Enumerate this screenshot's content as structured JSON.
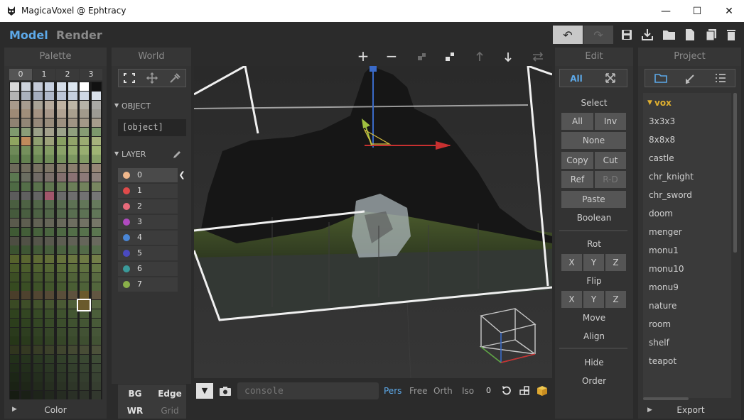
{
  "window": {
    "title": "MagicaVoxel @ Ephtracy",
    "minimize": "—",
    "maximize": "☐",
    "close": "✕"
  },
  "modes": {
    "model": "Model",
    "render": "Render"
  },
  "toolbar": {
    "undo": "↶",
    "redo": "↷"
  },
  "palette": {
    "header": "Palette",
    "indices": [
      "0",
      "1",
      "2",
      "3"
    ],
    "footer": "Color",
    "colors": [
      [
        "#d8d8d8",
        "#cdd3dc",
        "#c4cad7",
        "#c7d0e0",
        "#d5dde8",
        "#dce6f0",
        "#ffffff",
        "#111111"
      ],
      [
        "#b4b4b4",
        "#aab1bd",
        "#a5adbe",
        "#b0b8c9",
        "#bdc6d6",
        "#c6d0de",
        "#cfd8e5",
        "#d9e0ea"
      ],
      [
        "#a89a8c",
        "#a69c90",
        "#a8a396",
        "#b5aa9c",
        "#bfb3a3",
        "#bdb6a6",
        "#b6b3a8",
        "#a9a8a5"
      ],
      [
        "#9e8a76",
        "#a08e7a",
        "#a49282",
        "#a8988a",
        "#b0a292",
        "#a99f8e",
        "#a29a8c",
        "#9c9a93"
      ],
      [
        "#8f8272",
        "#928676",
        "#96887a",
        "#998c7c",
        "#9d9080",
        "#a09484",
        "#a39888",
        "#a69c8c"
      ],
      [
        "#7f9a6e",
        "#8b9d78",
        "#9aa088",
        "#a3a18c",
        "#9ba38a",
        "#91a07e",
        "#879c74",
        "#7c986c"
      ],
      [
        "#8fa560",
        "#c08b5c",
        "#8f9f70",
        "#9ca27a",
        "#88a062",
        "#92a46a",
        "#9bab72",
        "#a6b27c"
      ],
      [
        "#6e8a58",
        "#75905c",
        "#7c9660",
        "#839c64",
        "#8aa268",
        "#91a86c",
        "#98ae70",
        "#9fb474"
      ],
      [
        "#5e7d4c",
        "#648250",
        "#6a8754",
        "#708c58",
        "#76915c",
        "#7c9660",
        "#829b64",
        "#88a068"
      ],
      [
        "#6c6a5a",
        "#726e5e",
        "#787262",
        "#7e7666",
        "#847a6a",
        "#8a7e6e",
        "#908272",
        "#968676"
      ],
      [
        "#5b7850",
        "#6a6d60",
        "#716b66",
        "#7a6f6a",
        "#836f6e",
        "#8a7274",
        "#8c7a78",
        "#8e827c"
      ],
      [
        "#4e6a44",
        "#546e48",
        "#5a724c",
        "#607650",
        "#667a54",
        "#6c7e58",
        "#72825c",
        "#788660"
      ],
      [
        "#5c5c5c",
        "#606060",
        "#646464",
        "#a1566b",
        "#6a6a6a",
        "#6e6e6e",
        "#727272",
        "#767676"
      ],
      [
        "#4a5e40",
        "#4e6244",
        "#526648",
        "#566a4c",
        "#5a6e50",
        "#5e7254",
        "#627658",
        "#667a5c"
      ],
      [
        "#455a3c",
        "#495e40",
        "#4d6244",
        "#516648",
        "#556a4c",
        "#596e50",
        "#5d7254",
        "#617658"
      ],
      [
        "#5a5a4c",
        "#5e5e50",
        "#626254",
        "#666658",
        "#6a6a5c",
        "#6e6e60",
        "#727264",
        "#767668"
      ],
      [
        "#3f5a34",
        "#435e38",
        "#47623c",
        "#4b6640",
        "#4f6a44",
        "#536e48",
        "#57724c",
        "#5b7650"
      ],
      [
        "#4d4d42",
        "#515146",
        "#55554a",
        "#59594e",
        "#5d5d52",
        "#616156",
        "#65655a",
        "#69695e"
      ],
      [
        "#3b5230",
        "#3f5634",
        "#435a38",
        "#475e3c",
        "#4b6240",
        "#4f6644",
        "#536a48",
        "#576e4c"
      ],
      [
        "#56622c",
        "#5a6630",
        "#5e6a34",
        "#626e38",
        "#66723c",
        "#6a7640",
        "#6e7a44",
        "#727e48"
      ],
      [
        "#485a28",
        "#4c5e2c",
        "#506230",
        "#546634",
        "#586a38",
        "#5c6e3c",
        "#607240",
        "#647644"
      ],
      [
        "#3c4e24",
        "#405228",
        "#44562c",
        "#485a30",
        "#4c5e34",
        "#506238",
        "#54663c",
        "#586a40"
      ],
      [
        "#364a20",
        "#3a4e24",
        "#3e5228",
        "#42562c",
        "#465a30",
        "#4a5e34",
        "#4e6238",
        "#52663c"
      ],
      [
        "#4a3e2a",
        "#4e422e",
        "#524632",
        "#564a36",
        "#5a4e3a",
        "#5e523e",
        "#6a5a2c",
        "#625642"
      ],
      [
        "#3a4a24",
        "#3e4e28",
        "#42522c",
        "#465630",
        "#4a5a34",
        "#4e5e38",
        "#52623c",
        "#566640"
      ],
      [
        "#2f421e",
        "#334622",
        "#374a26",
        "#3b4e2a",
        "#3f522e",
        "#435632",
        "#475a36",
        "#4b5e3a"
      ],
      [
        "#2c3e1c",
        "#304220",
        "#344624",
        "#384a28",
        "#3c4e2c",
        "#405230",
        "#445634",
        "#485a38"
      ],
      [
        "#2a3a1c",
        "#2e3e20",
        "#324224",
        "#364628",
        "#3a4a2c",
        "#3e4e30",
        "#425234",
        "#465638"
      ],
      [
        "#263618",
        "#2a3a1c",
        "#2e3e20",
        "#324224",
        "#364628",
        "#3a4a2c",
        "#3e4e30",
        "#425234"
      ],
      [
        "#30351e",
        "#343922",
        "#383d26",
        "#3c412a",
        "#40452e",
        "#444932",
        "#484d36",
        "#4c513a"
      ],
      [
        "#22301a",
        "#26341e",
        "#2a3822",
        "#2e3c26",
        "#32402a",
        "#36442e",
        "#3a4832",
        "#3e4c36"
      ],
      [
        "#1f2b18",
        "#232f1c",
        "#273320",
        "#2b3724",
        "#2f3b28",
        "#333f2c",
        "#374330",
        "#3b4734"
      ],
      [
        "#1c2616",
        "#202a1a",
        "#242e1e",
        "#283222",
        "#2c3626",
        "#303a2a",
        "#343e2e",
        "#384232"
      ],
      [
        "#1a2214",
        "#1e2618",
        "#222a1c",
        "#262e20",
        "#2a3224",
        "#2e3628",
        "#323a2c",
        "#363e30"
      ],
      [
        "#161c12",
        "#1a2016",
        "#1e241a",
        "#22281e",
        "#262c22",
        "#2a3026",
        "#2e342a",
        "#32382e"
      ]
    ]
  },
  "world": {
    "header": "World",
    "object_section": "OBJECT",
    "object_value": "[object]",
    "layer_section": "LAYER",
    "layers": [
      {
        "name": "0",
        "color": "#f0b88c"
      },
      {
        "name": "1",
        "color": "#e04a4a"
      },
      {
        "name": "2",
        "color": "#e86a7a"
      },
      {
        "name": "3",
        "color": "#b04ac0"
      },
      {
        "name": "4",
        "color": "#4a86d6"
      },
      {
        "name": "5",
        "color": "#4a4ac0"
      },
      {
        "name": "6",
        "color": "#3a9a9a"
      },
      {
        "name": "7",
        "color": "#8ab04a"
      }
    ],
    "bg": "BG",
    "edge": "Edge",
    "wr": "WR",
    "grid": "Grid"
  },
  "viewport": {
    "add": "+",
    "remove": "−",
    "console_placeholder": "console",
    "pers": "Pers",
    "free": "Free",
    "orth": "Orth",
    "iso": "Iso",
    "zero": "0"
  },
  "edit": {
    "header": "Edit",
    "all_tab": "All",
    "select": "Select",
    "all": "All",
    "inv": "Inv",
    "none": "None",
    "copy": "Copy",
    "cut": "Cut",
    "ref": "Ref",
    "rd": "R-D",
    "paste": "Paste",
    "boolean": "Boolean",
    "rot": "Rot",
    "flip": "Flip",
    "x": "X",
    "y": "Y",
    "z": "Z",
    "move": "Move",
    "align": "Align",
    "hide": "Hide",
    "order": "Order"
  },
  "project": {
    "header": "Project",
    "folder": "vox",
    "items": [
      "3x3x3",
      "8x8x8",
      "castle",
      "chr_knight",
      "chr_sword",
      "doom",
      "menger",
      "monu1",
      "monu10",
      "monu9",
      "nature",
      "room",
      "shelf",
      "teapot"
    ],
    "export": "Export"
  },
  "colors": {
    "accent": "#5da9e9",
    "panel": "#333333",
    "button": "#555555"
  }
}
